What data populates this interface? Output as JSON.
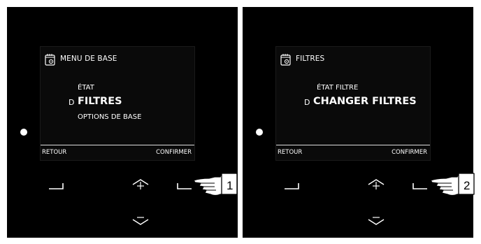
{
  "panels": [
    {
      "screen": {
        "title": "MENU DE BASE",
        "items": [
          "ÉTAT",
          "FILTRES",
          "OPTIONS DE BASE"
        ],
        "selected_index": 1,
        "cursor_glyph": "D",
        "soft_left": "RETOUR",
        "soft_right": "CONFIRMER"
      },
      "callout_number": "1"
    },
    {
      "screen": {
        "title": "FILTRES",
        "items": [
          "ÉTAT FILTRE",
          "CHANGER FILTRES"
        ],
        "selected_index": 1,
        "cursor_glyph": "D",
        "soft_left": "RETOUR",
        "soft_right": "CONFIRMER"
      },
      "callout_number": "2"
    }
  ],
  "icons": {
    "menu": "calendar-gear-icon",
    "left_key": "bracket-left-icon",
    "right_key": "bracket-right-icon",
    "up_key": "arrow-up-icon",
    "down_key": "arrow-down-icon",
    "hand": "pointing-hand-icon"
  },
  "colors": {
    "panel": "#000000",
    "text": "#ffffff",
    "background": "#ffffff"
  }
}
